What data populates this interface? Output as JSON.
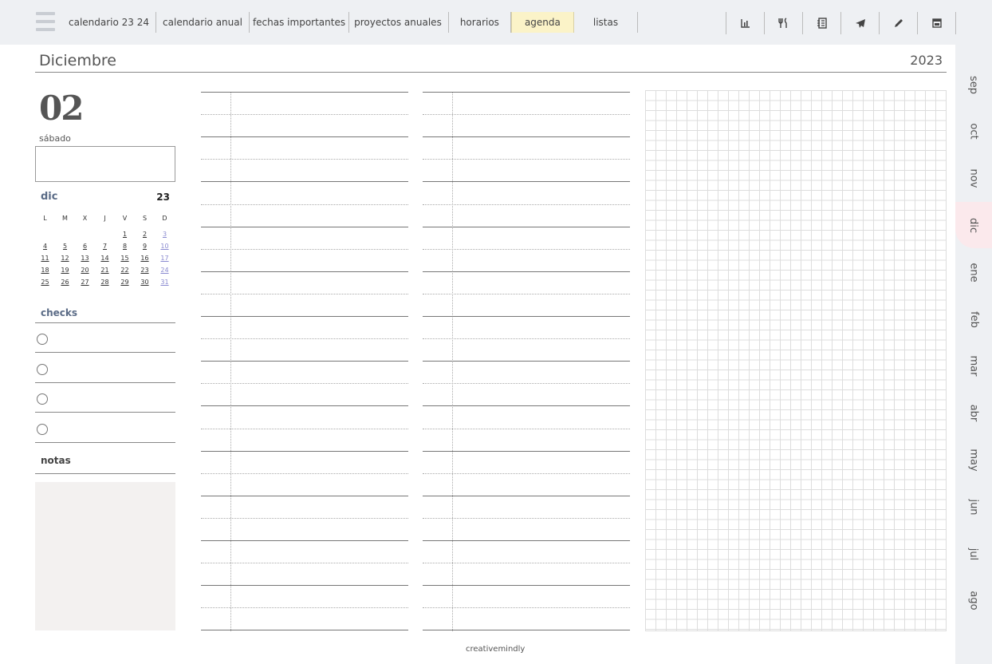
{
  "nav": {
    "tabs": [
      {
        "label": "calendario 23 24"
      },
      {
        "label": "calendario anual"
      },
      {
        "label": "fechas importantes"
      },
      {
        "label": "proyectos anuales"
      },
      {
        "label": "horarios"
      },
      {
        "label": "agenda",
        "active": true
      },
      {
        "label": "listas"
      }
    ],
    "tools": [
      "chart-icon",
      "cutlery-icon",
      "notebook-icon",
      "airplane-icon",
      "pencil-icon",
      "calendar-icon"
    ]
  },
  "header": {
    "month": "Diciembre",
    "year": "2023"
  },
  "day": {
    "number": "02",
    "weekday": "sábado"
  },
  "mini_calendar": {
    "month": "dic",
    "year": "23",
    "weekdays": [
      "L",
      "M",
      "X",
      "J",
      "V",
      "S",
      "D"
    ],
    "weeks": [
      [
        "",
        "",
        "",
        "",
        "1",
        "2",
        "3"
      ],
      [
        "4",
        "5",
        "6",
        "7",
        "8",
        "9",
        "10"
      ],
      [
        "11",
        "12",
        "13",
        "14",
        "15",
        "16",
        "17"
      ],
      [
        "18",
        "19",
        "20",
        "21",
        "22",
        "23",
        "24"
      ],
      [
        "25",
        "26",
        "27",
        "28",
        "29",
        "30",
        "31"
      ]
    ]
  },
  "checks": {
    "title": "checks",
    "count": 4
  },
  "notes": {
    "title": "notas"
  },
  "sidebar": {
    "months": [
      "sep",
      "oct",
      "nov",
      "dic",
      "ene",
      "feb",
      "mar",
      "abr",
      "may",
      "jun",
      "jul",
      "ago"
    ],
    "active": "dic"
  },
  "footer": {
    "brand": "creativemindly"
  }
}
